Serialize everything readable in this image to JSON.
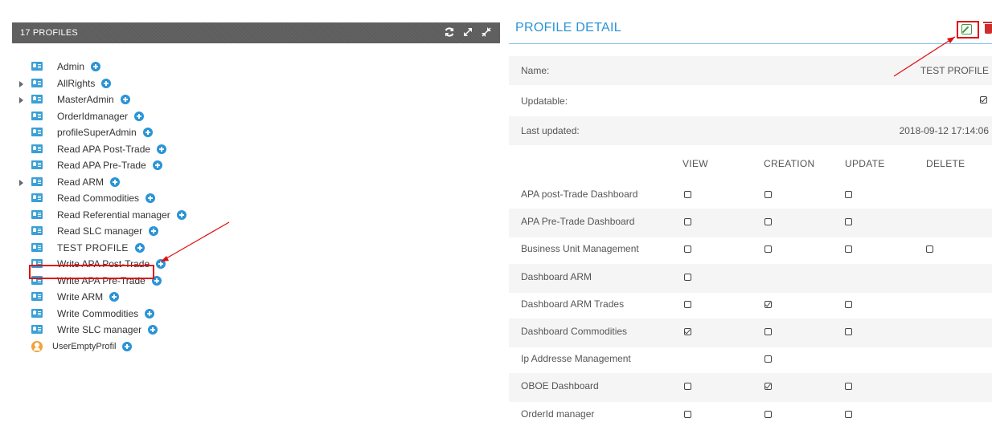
{
  "left_panel": {
    "title": "17 PROFILES",
    "icons": [
      "refresh-icon",
      "expand-icon",
      "collapse-icon"
    ]
  },
  "profiles": [
    {
      "label": "Admin",
      "expandable": false,
      "icon": "profile-card-icon"
    },
    {
      "label": "AllRights",
      "expandable": true,
      "icon": "profile-card-icon"
    },
    {
      "label": "MasterAdmin",
      "expandable": true,
      "icon": "profile-card-icon"
    },
    {
      "label": "OrderIdmanager",
      "expandable": false,
      "icon": "profile-card-icon"
    },
    {
      "label": "profileSuperAdmin",
      "expandable": false,
      "icon": "profile-card-icon"
    },
    {
      "label": "Read APA Post-Trade",
      "expandable": false,
      "icon": "profile-card-icon"
    },
    {
      "label": "Read APA Pre-Trade",
      "expandable": false,
      "icon": "profile-card-icon"
    },
    {
      "label": "Read ARM",
      "expandable": true,
      "icon": "profile-card-icon"
    },
    {
      "label": "Read Commodities",
      "expandable": false,
      "icon": "profile-card-icon"
    },
    {
      "label": "Read Referential manager",
      "expandable": false,
      "icon": "profile-card-icon"
    },
    {
      "label": "Read SLC manager",
      "expandable": false,
      "icon": "profile-card-icon"
    },
    {
      "label": "TEST PROFILE",
      "expandable": false,
      "icon": "profile-card-icon",
      "selected": true
    },
    {
      "label": "Write APA Post-Trade",
      "expandable": false,
      "icon": "profile-card-icon"
    },
    {
      "label": "Write APA Pre-Trade",
      "expandable": false,
      "icon": "profile-card-icon"
    },
    {
      "label": "Write ARM",
      "expandable": false,
      "icon": "profile-card-icon"
    },
    {
      "label": "Write Commodities",
      "expandable": false,
      "icon": "profile-card-icon"
    },
    {
      "label": "Write SLC manager",
      "expandable": false,
      "icon": "profile-card-icon"
    },
    {
      "label": "UserEmptyProfil",
      "expandable": false,
      "icon": "user-icon"
    }
  ],
  "detail": {
    "title": "PROFILE DETAIL",
    "name_label": "Name:",
    "name_value": "TEST PROFILE",
    "updatable_label": "Updatable:",
    "updatable_checked": true,
    "last_updated_label": "Last updated:",
    "last_updated_value": "2018-09-12 17:14:06",
    "columns": [
      "VIEW",
      "CREATION",
      "UPDATE",
      "DELETE"
    ],
    "permissions": [
      {
        "name": "APA post-Trade Dashboard",
        "view": false,
        "creation": false,
        "update": false,
        "delete": null
      },
      {
        "name": "APA Pre-Trade Dashboard",
        "view": false,
        "creation": false,
        "update": false,
        "delete": null
      },
      {
        "name": "Business Unit Management",
        "view": false,
        "creation": false,
        "update": false,
        "delete": false
      },
      {
        "name": "Dashboard ARM",
        "view": false,
        "creation": null,
        "update": null,
        "delete": null
      },
      {
        "name": "Dashboard ARM Trades",
        "view": false,
        "creation": true,
        "update": false,
        "delete": null
      },
      {
        "name": "Dashboard Commodities",
        "view": true,
        "creation": false,
        "update": false,
        "delete": null
      },
      {
        "name": "Ip Addresse Management",
        "view": null,
        "creation": false,
        "update": null,
        "delete": null
      },
      {
        "name": "OBOE Dashboard",
        "view": false,
        "creation": true,
        "update": false,
        "delete": null
      },
      {
        "name": "OrderId manager",
        "view": false,
        "creation": false,
        "update": false,
        "delete": null
      }
    ]
  },
  "colors": {
    "accent": "#2a94d6",
    "annotation_red": "#e01010",
    "header_bg": "#5d5d5d",
    "edit_green": "#3d9a3d",
    "delete_red": "#d12c2c"
  }
}
